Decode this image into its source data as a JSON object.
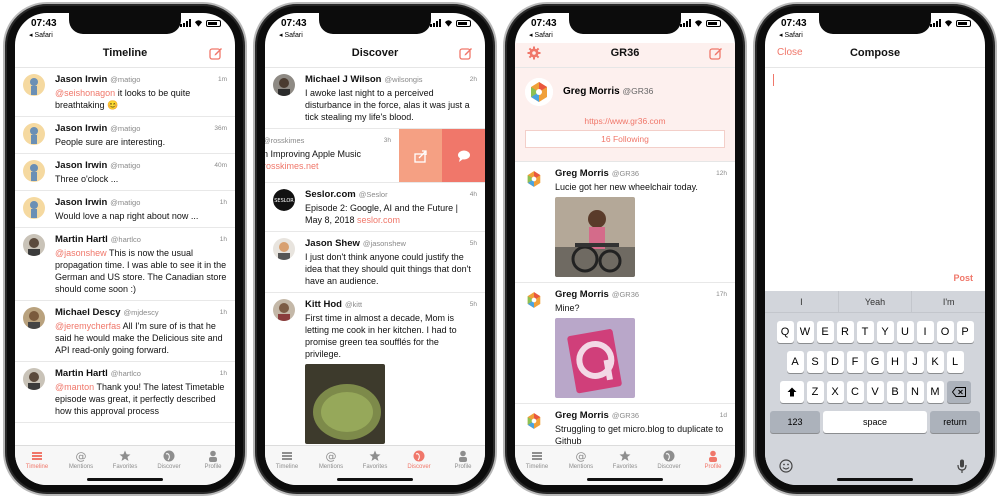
{
  "status": {
    "time": "07:43",
    "back": "◂ Safari"
  },
  "tabs": [
    "Timeline",
    "Mentions",
    "Favorites",
    "Discover",
    "Profile"
  ],
  "colors": {
    "accent": "#f0776a",
    "profile_bg": "#fdf0ee"
  },
  "screen1": {
    "title": "Timeline",
    "posts": [
      {
        "name": "Jason Irwin",
        "user": "@matigo",
        "time": "1m",
        "mention": "@seishonagon",
        "text": " it looks to be quite breathtaking 😊"
      },
      {
        "name": "Jason Irwin",
        "user": "@matigo",
        "time": "36m",
        "text": "People sure are interesting."
      },
      {
        "name": "Jason Irwin",
        "user": "@matigo",
        "time": "40m",
        "text": "Three o'clock ..."
      },
      {
        "name": "Jason Irwin",
        "user": "@matigo",
        "time": "1h",
        "text": "Would love a nap right about now ..."
      },
      {
        "name": "Martin Hartl",
        "user": "@hartlco",
        "time": "1h",
        "mention": "@jasonshew",
        "text": " This is now the usual propagation time. I was able to see it in the German and US store. The Canadian store should come soon :)"
      },
      {
        "name": "Michael Descy",
        "user": "@mjdescy",
        "time": "1h",
        "mention": "@jeremycherfas",
        "text": " All I'm sure of is that he said he would make the Delicious site and API read-only going forward."
      },
      {
        "name": "Martin Hartl",
        "user": "@hartlco",
        "time": "1h",
        "mention": "@manton",
        "text": " Thank you! The latest Timetable episode was great, it perfectly described how this approval process"
      }
    ]
  },
  "screen2": {
    "title": "Discover",
    "posts": [
      {
        "name": "Michael J Wilson",
        "user": "@wilsongis",
        "time": "2h",
        "text": "I awoke last night to a perceived disturbance in the force, alas it was just a tick stealing my life's blood."
      },
      {
        "name": "",
        "user": "@rosskimes",
        "time": "3h",
        "text": "n Improving Apple Music",
        "link": "rosskimes.net"
      },
      {
        "name": "Seslor.com",
        "user": "@Seslor",
        "time": "4h",
        "text": "Episode 2: Google, AI and the Future | May 8, 2018 ",
        "link": "seslor.com"
      },
      {
        "name": "Jason Shew",
        "user": "@jasonshew",
        "time": "5h",
        "text": "I just don't think anyone could justify the idea that they should quit things that don't have an audience."
      },
      {
        "name": "Kitt Hod",
        "user": "@kitt",
        "time": "5h",
        "text": "First time in almost a decade, Mom is letting me cook in her kitchen. I had to promise green tea soufflés for the privilege."
      }
    ]
  },
  "screen3": {
    "title": "GR36",
    "profile_name": "Greg Morris",
    "profile_user": "@GR36",
    "url": "https://www.gr36.com",
    "following": "16 Following",
    "posts": [
      {
        "name": "Greg Morris",
        "user": "@GR36",
        "time": "12h",
        "text": "Lucie got her new wheelchair today."
      },
      {
        "name": "Greg Morris",
        "user": "@GR36",
        "time": "17h",
        "text": "Mine?"
      },
      {
        "name": "Greg Morris",
        "user": "@GR36",
        "time": "1d",
        "text": "Struggling to get micro.blog to duplicate to Github"
      }
    ]
  },
  "screen4": {
    "title": "Compose",
    "close": "Close",
    "post": "Post",
    "suggestions": [
      "I",
      "Yeah",
      "I'm"
    ],
    "rows": [
      [
        "Q",
        "W",
        "E",
        "R",
        "T",
        "Y",
        "U",
        "I",
        "O",
        "P"
      ],
      [
        "A",
        "S",
        "D",
        "F",
        "G",
        "H",
        "J",
        "K",
        "L"
      ],
      [
        "Z",
        "X",
        "C",
        "V",
        "B",
        "N",
        "M"
      ]
    ],
    "num_key": "123",
    "space_key": "space",
    "return_key": "return"
  }
}
